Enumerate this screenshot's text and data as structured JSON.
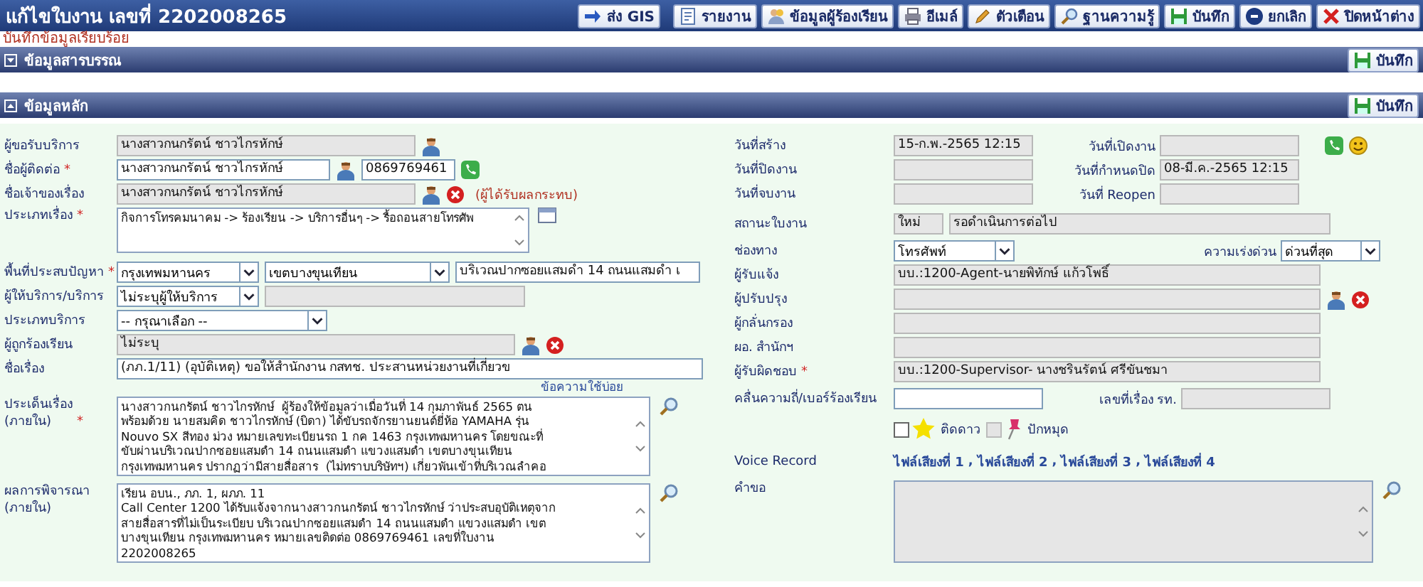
{
  "header": {
    "title": "แก้ไขใบงาน เลขที่ 2202008265",
    "buttons": [
      {
        "label": "ส่ง GIS",
        "kind": "arrow"
      },
      {
        "label": "รายงาน",
        "kind": "report"
      },
      {
        "label": "ข้อมูลผู้ร้องเรียน",
        "kind": "people"
      },
      {
        "label": "อีเมล์",
        "kind": "print"
      },
      {
        "label": "ตัวเตือน",
        "kind": "bell"
      },
      {
        "label": "ฐานความรู้",
        "kind": "search"
      },
      {
        "label": "บันทึก",
        "kind": "save"
      },
      {
        "label": "ยกเลิก",
        "kind": "cancel"
      },
      {
        "label": "ปิดหน้าต่าง",
        "kind": "close"
      }
    ]
  },
  "message": "บันทึกข้อมูลเรียบร้อย",
  "sections": [
    {
      "title": "ข้อมูลสารบรรณ",
      "expanded": false,
      "save": "บันทึก"
    },
    {
      "title": "ข้อมูลหลัก",
      "expanded": true,
      "save": "บันทึก"
    }
  ],
  "left": [
    {
      "label": "ผู้ขอรับบริการ",
      "controls": [
        {
          "kind": "field",
          "value": "นางสาวกนกรัตน์ ชาวไกรหักษ์"
        },
        {
          "kind": "person"
        }
      ]
    },
    {
      "label": "ชื่อผู้ติดต่อ",
      "mark": "*",
      "controls": [
        {
          "kind": "entry",
          "value": "นางสาวกนกรัตน์ ชาวไกรหักษ์"
        },
        {
          "kind": "person"
        },
        {
          "kind": "entry",
          "value": "0869769461"
        },
        {
          "kind": "phone"
        }
      ]
    },
    {
      "label": "ชื่อเจ้าของเรื่อง",
      "controls": [
        {
          "kind": "field",
          "value": "นางสาวกนกรัตน์ ชาวไกรหักษ์"
        },
        {
          "kind": "person"
        },
        {
          "kind": "remove"
        },
        {
          "kind": "note",
          "value": "(ผู้ได้รับผลกระทบ)"
        }
      ]
    },
    {
      "label": "ประเภทเรื่อง",
      "mark": "*",
      "controls": [
        {
          "kind": "textarea",
          "value": "กิจการโทรคมนาคม -> ร้องเรียน -> บริการอื่นๆ -> รื้อถอนสายโทรศัพ"
        },
        {
          "kind": "calendar"
        }
      ]
    },
    {
      "label": "พื้นที่ประสบปัญหา",
      "mark": "*",
      "controls": [
        {
          "kind": "select",
          "value": "กรุงเทพมหานคร"
        },
        {
          "kind": "select",
          "value": "เขตบางขุนเทียน"
        },
        {
          "kind": "entry",
          "value": "บริเวณปากซอยแสมดำ 14 ถนนแสมดำ เ"
        }
      ]
    },
    {
      "label": "ผู้ให้บริการ/บริการ",
      "controls": [
        {
          "kind": "select",
          "value": "ไม่ระบุผู้ให้บริการ"
        },
        {
          "kind": "field"
        }
      ]
    },
    {
      "label": "ประเภทบริการ",
      "controls": [
        {
          "kind": "select",
          "value": "-- กรุณาเลือก --"
        }
      ]
    },
    {
      "label": "ผู้ถูกร้องเรียน",
      "controls": [
        {
          "kind": "field",
          "value": "ไม่ระบุ"
        },
        {
          "kind": "person"
        },
        {
          "kind": "remove"
        }
      ]
    },
    {
      "label": "ชื่อเรื่อง",
      "controls": [
        {
          "kind": "entry",
          "value": "(ภภ.1/11) (อุบัติเหตุ) ขอให้สำนักงาน กสทช. ประสานหน่วยงานที่เกี่ยวข"
        }
      ]
    },
    {
      "controls": [
        {
          "kind": "link",
          "value": "ข้อความใช้บ่อย"
        }
      ]
    },
    {
      "label": "ประเด็นเรื่อง\n(ภายใน)",
      "mark": "*",
      "controls": [
        {
          "kind": "textarea",
          "value": "นางสาวกนกรัตน์ ชาวไกรหักษ์  ผู้ร้องให้ข้อมูลว่าเมื่อวันที่ 14 กุมภาพันธ์ 2565 ตน\nพร้อมด้วย นายสมคิด ชาวไกรหักษ์ (บิดา) ได้ขับรถจักรยานยนต์ยี่ห้อ YAMAHA รุ่น\nNouvo SX สีทอง ม่วง หมายเลขทะเบียนรถ 1 กค 1463 กรุงเทพมหานคร โดยขณะที่\nขับผ่านบริเวณปากซอยแสมดำ 14 ถนนแสมดำ แขวงแสมดำ เขตบางขุนเทียน\nกรุงเทพมหานคร ปรากฏว่ามีสายสื่อสาร  (ไม่ทราบบริษัทฯ) เกี่ยวพันเข้าที่บริเวณลำคอ"
        },
        {
          "kind": "zoom"
        }
      ]
    },
    {
      "label": "ผลการพิจารณา\n(ภายใน)",
      "controls": [
        {
          "kind": "textarea",
          "value": "เรียน อบน., ภภ. 1, ผภภ. 11\nCall Center 1200 ได้รับแจ้งจากนางสาวกนกรัตน์ ชาวไกรหักษ์ ว่าประสบอุบัติเหตุจาก\nสายสื่อสารที่ไม่เป็นระเบียบ บริเวณปากซอยแสมดำ 14 ถนนแสมดำ แขวงแสมดำ เขต\nบางขุนเทียน กรุงเทพมหานคร หมายเลขติดต่อ 0869769461 เลขที่ใบงาน\n2202008265"
        },
        {
          "kind": "zoom"
        }
      ]
    }
  ],
  "right": [
    {
      "label": "วันที่สร้าง",
      "controls": [
        {
          "kind": "field",
          "value": "15-ก.พ.-2565 12:15"
        },
        {
          "kind": "sublabel",
          "value": "วันที่เปิดงาน"
        },
        {
          "kind": "field"
        },
        {
          "kind": "phone"
        },
        {
          "kind": "smiley"
        }
      ]
    },
    {
      "label": "วันที่ปิดงาน",
      "controls": [
        {
          "kind": "field"
        },
        {
          "kind": "sublabel",
          "value": "วันที่กำหนดปิด"
        },
        {
          "kind": "field",
          "value": "08-มี.ค.-2565 12:15"
        }
      ]
    },
    {
      "label": "วันที่จบงาน",
      "controls": [
        {
          "kind": "field"
        },
        {
          "kind": "sublabel",
          "value": "วันที่ Reopen"
        },
        {
          "kind": "field"
        }
      ]
    },
    {
      "label": "สถานะใบงาน",
      "controls": [
        {
          "kind": "field",
          "value": "ใหม่"
        },
        {
          "kind": "field",
          "value": "รอดำเนินการต่อไป"
        }
      ]
    },
    {
      "label": "ช่องทาง",
      "controls": [
        {
          "kind": "select",
          "value": "โทรศัพท์"
        },
        {
          "kind": "sublabel",
          "value": "ความเร่งด่วน"
        },
        {
          "kind": "select",
          "value": "ด่วนที่สุด"
        }
      ]
    },
    {
      "label": "ผู้รับแจ้ง",
      "controls": [
        {
          "kind": "field",
          "value": "บบ.:1200-Agent-นายพิทักษ์ แก้วโพธิ์"
        }
      ]
    },
    {
      "label": "ผู้ปรับปรุง",
      "controls": [
        {
          "kind": "field"
        },
        {
          "kind": "person"
        },
        {
          "kind": "remove"
        }
      ]
    },
    {
      "label": "ผู้กลั่นกรอง",
      "controls": [
        {
          "kind": "field"
        }
      ]
    },
    {
      "label": "ผอ. สำนักฯ",
      "controls": [
        {
          "kind": "field"
        }
      ]
    },
    {
      "label": "ผู้รับผิดชอบ",
      "mark": "*",
      "controls": [
        {
          "kind": "field",
          "value": "บบ.:1200-Supervisor- นางชรินรัตน์  ศรีขันชมา"
        }
      ]
    },
    {
      "label": "คลื่นความถี่/เบอร์ร้องเรียน",
      "controls": [
        {
          "kind": "entry"
        },
        {
          "kind": "sublabel",
          "value": "เลขที่เรื่อง รท."
        },
        {
          "kind": "field"
        }
      ]
    },
    {
      "controls": [
        {
          "kind": "check",
          "checked": false,
          "disabled": false,
          "value": "ติดดาว"
        },
        {
          "kind": "check",
          "checked": false,
          "disabled": true,
          "value": "ปักหมุด"
        }
      ]
    },
    {
      "label": "Voice Record",
      "controls": [
        {
          "kind": "files",
          "files": [
            {
              "label": "ไฟล์เสียงที่ 1",
              "separator": ","
            },
            {
              "label": "ไฟล์เสียงที่ 2",
              "separator": ","
            },
            {
              "label": "ไฟล์เสียงที่ 3",
              "separator": ","
            },
            {
              "label": "ไฟล์เสียงที่ 4"
            }
          ]
        }
      ]
    },
    {
      "label": "คำขอ",
      "controls": [
        {
          "kind": "textarea"
        },
        {
          "kind": "zoom"
        }
      ]
    }
  ]
}
